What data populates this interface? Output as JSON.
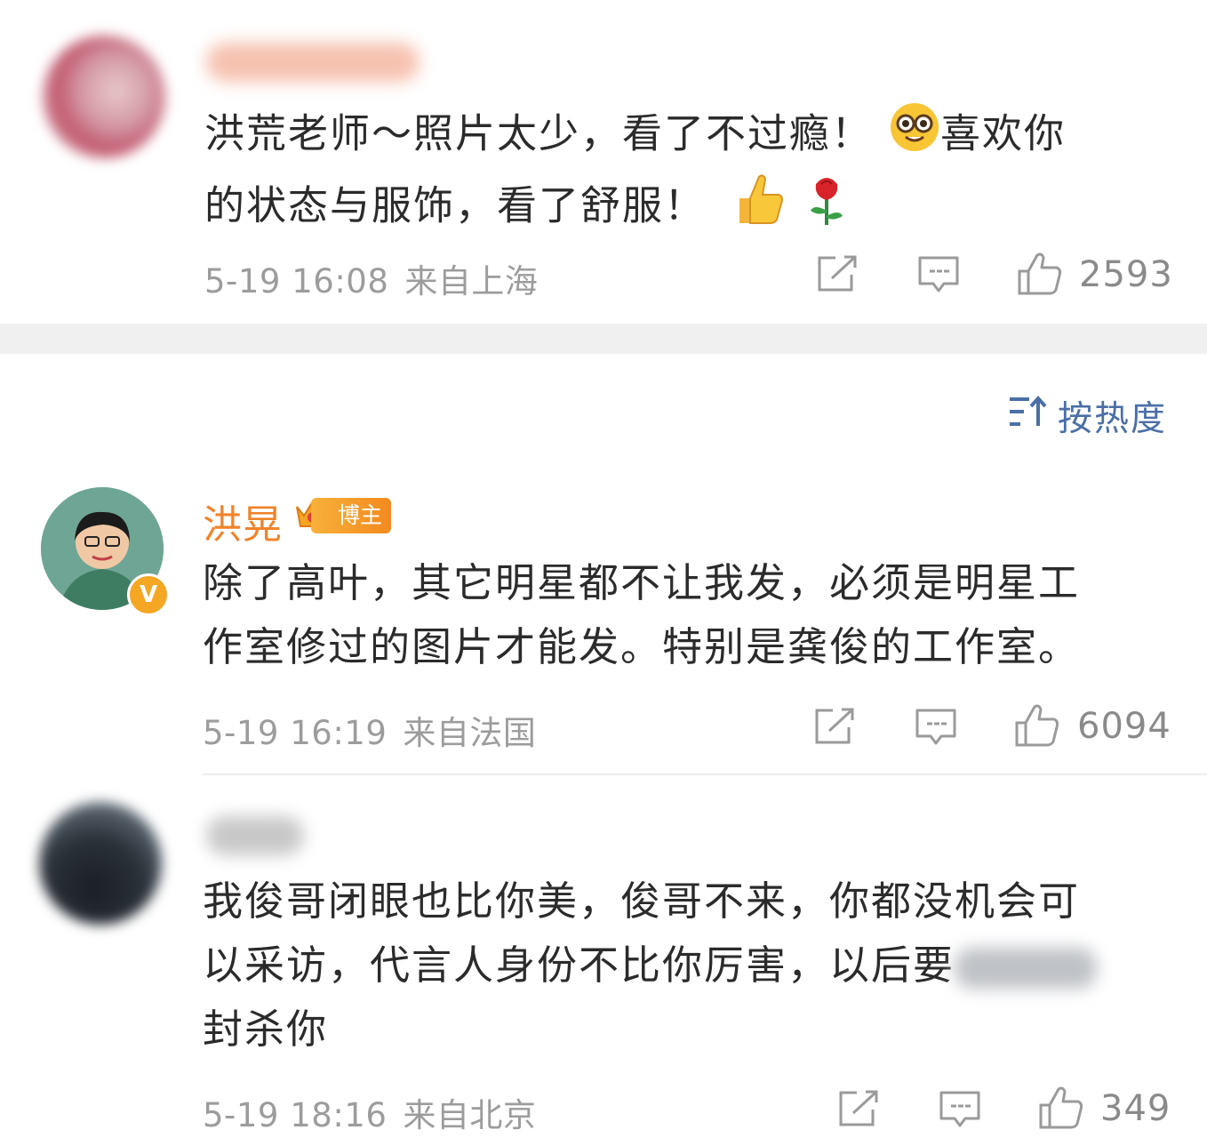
{
  "comments": [
    {
      "id": "c1",
      "username_hidden": true,
      "lines": [
        "洪荒老师～照片太少，看了不过瘾！",
        "喜欢你",
        "的状态与服饰，看了舒服！"
      ],
      "emojis": [
        "nerd-face-emoji",
        "thumbs-up-emoji",
        "rose-emoji"
      ],
      "time": "5-19 16:08",
      "location": "来自上海",
      "likes": "2593"
    },
    {
      "id": "c2",
      "username": "洪晃",
      "badge": "博主",
      "verified": "V",
      "lines": [
        "除了高叶，其它明星都不让我发，必须是明星工",
        "作室修过的图片才能发。特别是龚俊的工作室。"
      ],
      "time": "5-19 16:19",
      "location": "来自法国",
      "likes": "6094"
    },
    {
      "id": "c3",
      "username_hidden": true,
      "lines": [
        "我俊哥闭眼也比你美，俊哥不来，你都没机会可",
        "以采访，代言人身份不比你厉害，以后要",
        "封杀你"
      ],
      "time": "5-19 18:16",
      "location": "来自北京",
      "likes": "349"
    }
  ],
  "sort": {
    "label": "按热度",
    "icon": "sort-icon"
  },
  "colors": {
    "accent": "#f0832a",
    "link": "#4b6fa6",
    "meta": "#9c9c9c"
  }
}
